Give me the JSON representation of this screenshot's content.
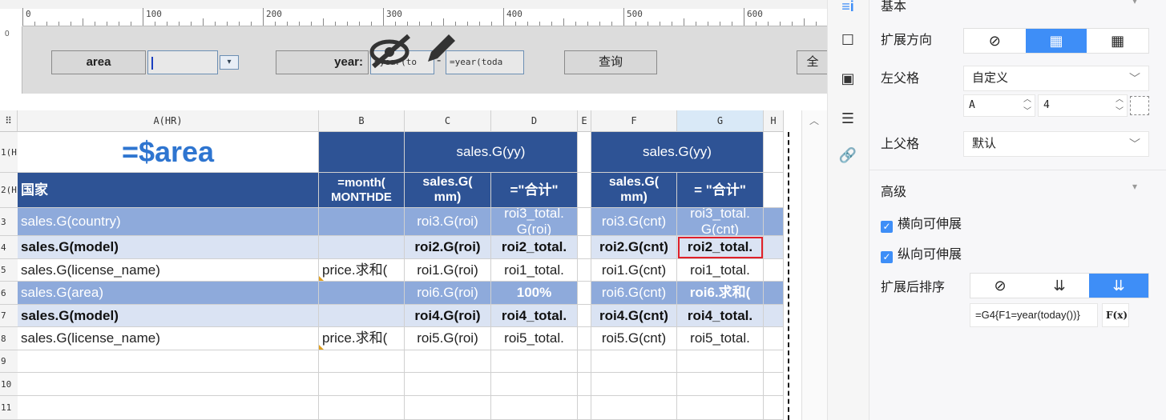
{
  "ruler": {
    "marks": [
      "0",
      "100",
      "200",
      "300",
      "400",
      "500",
      "600"
    ]
  },
  "params": {
    "area_label": "area",
    "area_value": "",
    "year_label": "year:",
    "year_from": "=year(to",
    "year_to": "=year(toda",
    "query_button": "查询",
    "extra_button": "全"
  },
  "grid": {
    "columns": [
      "A(HR)",
      "B",
      "C",
      "D",
      "E",
      "F",
      "G",
      "H"
    ],
    "rows": [
      "1(H)",
      "2(H)",
      "3",
      "4",
      "5",
      "6",
      "7",
      "8",
      "9",
      "10",
      "11"
    ],
    "cells": {
      "a1": "=$area",
      "b1": "",
      "cd1": "sales.G(yy)",
      "fg1": "sales.G(yy)",
      "a2": "国家",
      "b2": "=month(\nMONTHDE",
      "c2": "sales.G(\nmm)",
      "d2": "=\"合计\"",
      "f2": "sales.G(\nmm)",
      "g2": "= \"合计\"",
      "a3": "sales.G(country)",
      "c3": "roi3.G(roi)",
      "d3": "roi3_total.\nG(roi)",
      "f3": "roi3.G(cnt)",
      "g3": "roi3_total.\nG(cnt)",
      "a4": "sales.G(model)",
      "c4": "roi2.G(roi)",
      "d4": "roi2_total.",
      "f4": "roi2.G(cnt)",
      "g4": "roi2_total.",
      "a5": "sales.G(license_name)",
      "b5": "price.求和(",
      "c5": "roi1.G(roi)",
      "d5": "roi1_total.",
      "f5": "roi1.G(cnt)",
      "g5": "roi1_total.",
      "a6": "sales.G(area)",
      "c6": "roi6.G(roi)",
      "d6": "100%",
      "f6": "roi6.G(cnt)",
      "g6": "roi6.求和(",
      "a7": "sales.G(model)",
      "c7": "roi4.G(roi)",
      "d7": "roi4_total.",
      "f7": "roi4.G(cnt)",
      "g7": "roi4_total.",
      "a8": "sales.G(license_name)",
      "b8": "price.求和(",
      "c8": "roi5.G(roi)",
      "d8": "roi5_total.",
      "f8": "roi5.G(cnt)",
      "g8": "roi5_total."
    }
  },
  "panel": {
    "basic_header": "基本",
    "expand_dir_label": "扩展方向",
    "left_parent_label": "左父格",
    "left_parent_value": "自定义",
    "left_parent_col": "A",
    "left_parent_row": "4",
    "up_parent_label": "上父格",
    "up_parent_value": "默认",
    "advanced_header": "高级",
    "h_expand": "横向可伸展",
    "v_expand": "纵向可伸展",
    "sort_label": "扩展后排序",
    "formula": "=G4{F1=year(today())}",
    "fx_label": "F(x)"
  },
  "colors": {
    "dark": "#2e5395",
    "mid": "#8eaadb",
    "light": "#dae3f3",
    "accent": "#3e8ef7",
    "selection": "#e0202a"
  }
}
